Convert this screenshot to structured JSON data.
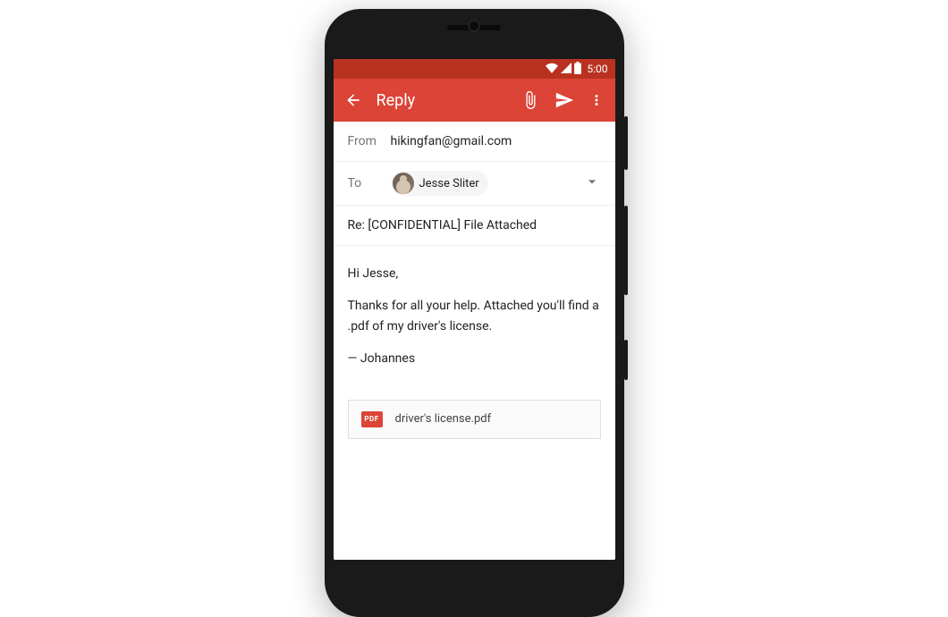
{
  "status_bar": {
    "time": "5:00"
  },
  "app_bar": {
    "title": "Reply"
  },
  "compose": {
    "from_label": "From",
    "from_value": "hikingfan@gmail.com",
    "to_label": "To",
    "to_chip_name": "Jesse Sliter",
    "subject": "Re: [CONFIDENTIAL] File Attached",
    "body_greeting": "Hi Jesse,",
    "body_main": "Thanks for all your help. Attached you'll find a .pdf of my driver's license.",
    "body_signature": "— Johannes"
  },
  "attachment": {
    "icon_label": "PDF",
    "filename": "driver's license.pdf"
  },
  "colors": {
    "primary": "#db4437",
    "primary_dark": "#b93221"
  }
}
